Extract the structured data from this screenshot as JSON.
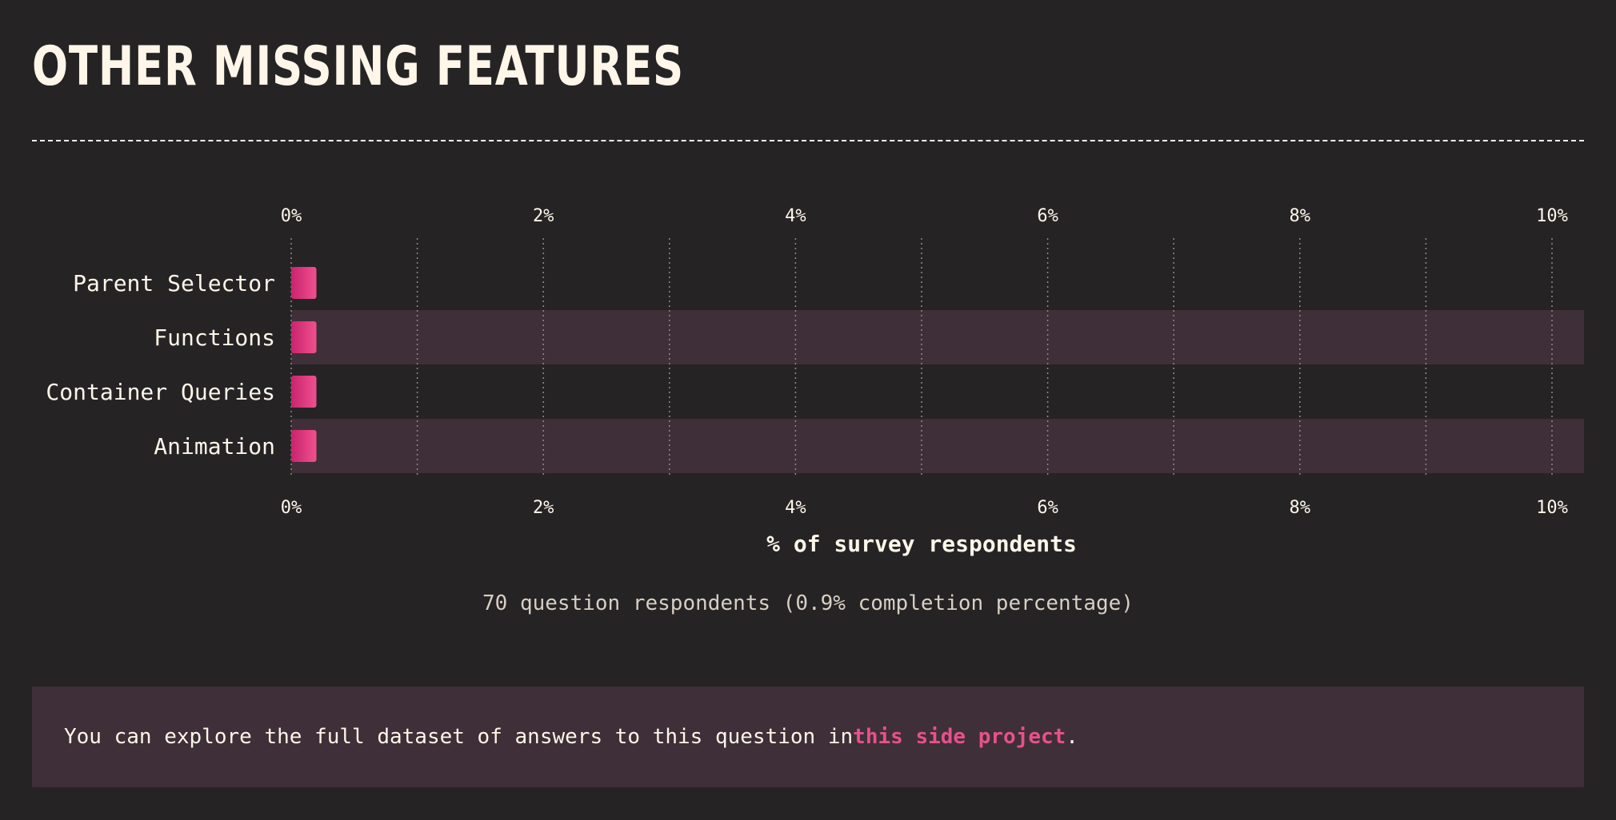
{
  "page": {
    "title": "OTHER MISSING FEATURES",
    "note": "70 question respondents (0.9% completion percentage)",
    "callout": {
      "prefix": "You can explore the full dataset of answers to this question in ",
      "link_text": "this side project",
      "suffix": "."
    }
  },
  "colors": {
    "background": "#262325",
    "text": "#fdf6e9",
    "band": "#3f2f38",
    "bar_start": "#c8246c",
    "bar_end": "#f0508f",
    "grid": "#8f8a8c",
    "link": "#e8508c"
  },
  "chart_data": {
    "type": "bar",
    "orientation": "horizontal",
    "categories": [
      "Parent Selector",
      "Functions",
      "Container Queries",
      "Animation"
    ],
    "values": [
      0.2,
      0.2,
      0.2,
      0.2
    ],
    "xlabel": "% of survey respondents",
    "xlim": [
      0,
      10
    ],
    "ticks": [
      "0%",
      "2%",
      "4%",
      "6%",
      "8%",
      "10%"
    ],
    "grid": true,
    "alternating_row_bands": true
  }
}
